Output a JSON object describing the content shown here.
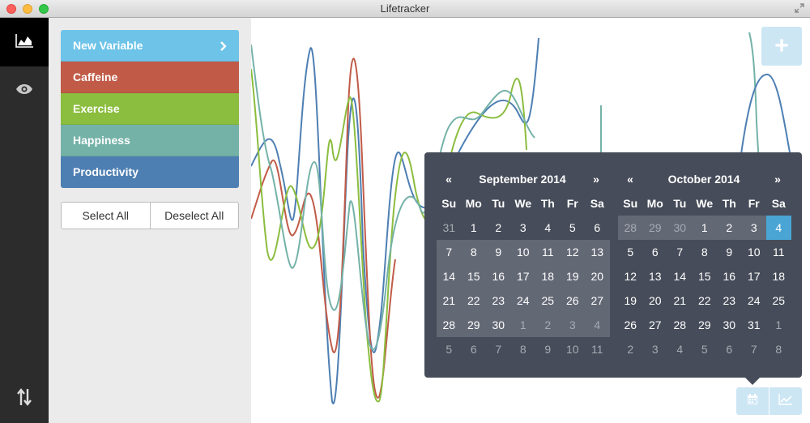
{
  "window": {
    "title": "Lifetracker"
  },
  "nav": {
    "items": [
      {
        "icon": "area-chart-icon",
        "active": true
      },
      {
        "icon": "eye-icon",
        "active": false
      }
    ],
    "bottom_icon": "sort-arrows-icon"
  },
  "sidebar": {
    "new_variable_label": "New Variable",
    "variables": [
      {
        "label": "Caffeine",
        "color": "#c15b48"
      },
      {
        "label": "Exercise",
        "color": "#8bbd3e"
      },
      {
        "label": "Happiness",
        "color": "#74b2a8"
      },
      {
        "label": "Productivity",
        "color": "#4e7fb3"
      }
    ],
    "select_all_label": "Select All",
    "deselect_all_label": "Deselect All"
  },
  "chart": {
    "add_button": "+"
  },
  "datepicker": {
    "prev": "«",
    "next": "»",
    "weekdays": [
      "Su",
      "Mo",
      "Tu",
      "We",
      "Th",
      "Fr",
      "Sa"
    ],
    "left": {
      "title": "September 2014",
      "weeks": [
        [
          "31",
          "1",
          "2",
          "3",
          "4",
          "5",
          "6"
        ],
        [
          "7",
          "8",
          "9",
          "10",
          "11",
          "12",
          "13"
        ],
        [
          "14",
          "15",
          "16",
          "17",
          "18",
          "19",
          "20"
        ],
        [
          "21",
          "22",
          "23",
          "24",
          "25",
          "26",
          "27"
        ],
        [
          "28",
          "29",
          "30",
          "1",
          "2",
          "3",
          "4"
        ],
        [
          "5",
          "6",
          "7",
          "8",
          "9",
          "10",
          "11"
        ]
      ]
    },
    "right": {
      "title": "October 2014",
      "weeks": [
        [
          "28",
          "29",
          "30",
          "1",
          "2",
          "3",
          "4"
        ],
        [
          "5",
          "6",
          "7",
          "8",
          "9",
          "10",
          "11"
        ],
        [
          "12",
          "13",
          "14",
          "15",
          "16",
          "17",
          "18"
        ],
        [
          "19",
          "20",
          "21",
          "22",
          "23",
          "24",
          "25"
        ],
        [
          "26",
          "27",
          "28",
          "29",
          "30",
          "31",
          "1"
        ],
        [
          "2",
          "3",
          "4",
          "5",
          "6",
          "7",
          "8"
        ]
      ]
    }
  },
  "bottom_toolbar": {
    "icons": [
      "calendar-icon",
      "line-chart-icon"
    ]
  }
}
